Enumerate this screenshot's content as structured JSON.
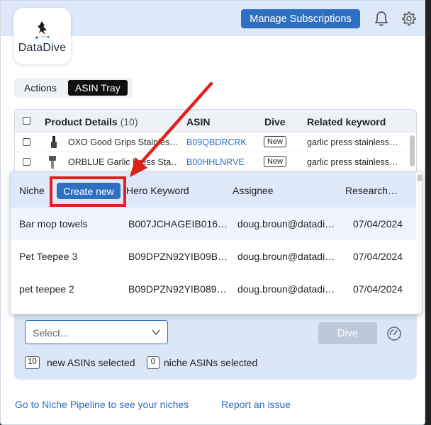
{
  "header": {
    "brand_name": "DataDive",
    "manage_button": "Manage Subscriptions",
    "icons": {
      "notifications": "bell-icon",
      "settings": "gear-icon"
    },
    "colors": {
      "accent": "#2f6fc2",
      "band": "#dde8f8"
    }
  },
  "view_toggle": {
    "options": [
      "Actions",
      "ASIN Tray"
    ],
    "active": "ASIN Tray"
  },
  "product_table": {
    "columns": {
      "details": "Product Details",
      "details_count": "(10)",
      "asin": "ASIN",
      "dive": "Dive",
      "keyword": "Related keyword"
    },
    "rows": [
      {
        "name": "OXO Good Grips Stainles…",
        "asin": "B09QBDRCRK",
        "dive": "New",
        "keyword": "garlic press stainless…"
      },
      {
        "name": "ORBLUE Garlic Press Sta…",
        "asin": "B00HHLNRVE",
        "dive": "New",
        "keyword": "garlic press stainless…"
      }
    ]
  },
  "niche_popup": {
    "columns": {
      "niche": "Niche",
      "create": "Create new",
      "hero": "Hero Keyword",
      "assignee": "Assignee",
      "research": "Research…"
    },
    "rows": [
      {
        "niche": "Bar mop towels",
        "hero": "B007JCHAGEIB016…",
        "assignee": "doug.broun@datadi…",
        "date": "07/04/2024"
      },
      {
        "niche": "Pet Teepee 3",
        "hero": "B09DPZN92YIB09B…",
        "assignee": "doug.broun@datadi…",
        "date": "07/04/2024"
      },
      {
        "niche": "pet teepee 2",
        "hero": "B09DPZN92YIB089…",
        "assignee": "doug.broun@datadi…",
        "date": "07/04/2024"
      }
    ],
    "highlight_color": "#e2201b"
  },
  "selection_panel": {
    "select_placeholder": "Select...",
    "dive_button": "Dive",
    "new_count": "10",
    "new_label": "new ASINs selected",
    "niche_count": "0",
    "niche_label": "niche ASINs selected"
  },
  "footer": {
    "pipeline_link": "Go to Niche Pipeline to see your niches",
    "report_link": "Report an issue"
  }
}
